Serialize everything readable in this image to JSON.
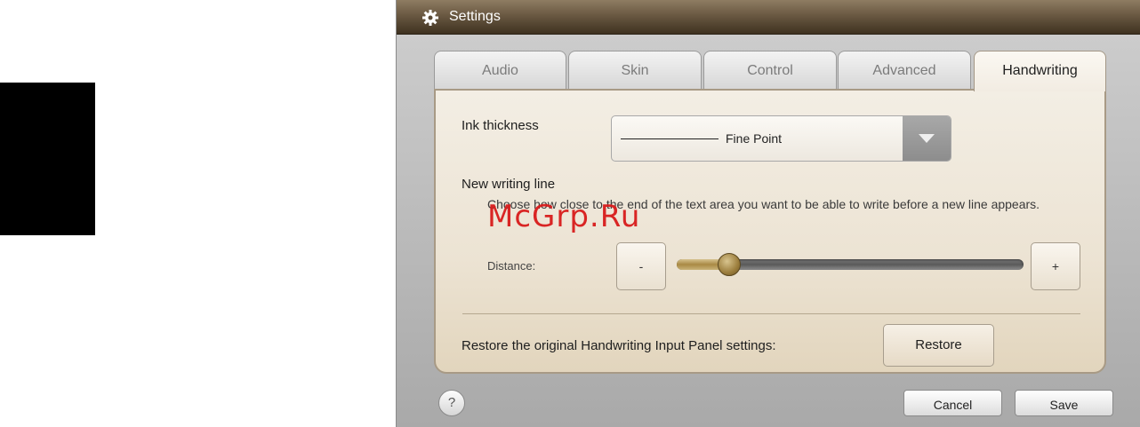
{
  "window": {
    "title": "Settings",
    "title_icon": "gear-icon"
  },
  "tabs": [
    {
      "label": "Audio",
      "active": false
    },
    {
      "label": "Skin",
      "active": false
    },
    {
      "label": "Control",
      "active": false
    },
    {
      "label": "Advanced",
      "active": false
    },
    {
      "label": "Handwriting",
      "active": true
    }
  ],
  "handwriting": {
    "ink_thickness_label": "Ink thickness",
    "ink_thickness_value": "Fine Point",
    "new_writing_line_label": "New writing line",
    "new_writing_line_desc": "Choose how close to the end of the text area you want to be able to write before a new line appears.",
    "distance_label": "Distance:",
    "decrease_label": "-",
    "increase_label": "+",
    "distance_fraction": 0.15,
    "restore_text": "Restore the original Handwriting Input Panel settings:",
    "restore_button": "Restore"
  },
  "watermark": "McGrp.Ru",
  "footer": {
    "help_label": "?",
    "cancel_label": "Cancel",
    "save_label": "Save"
  },
  "colors": {
    "titlebar": "#5a4a35",
    "panel": "#efe7d9",
    "slider_thumb": "#a98a44",
    "watermark": "#d81b1b"
  }
}
